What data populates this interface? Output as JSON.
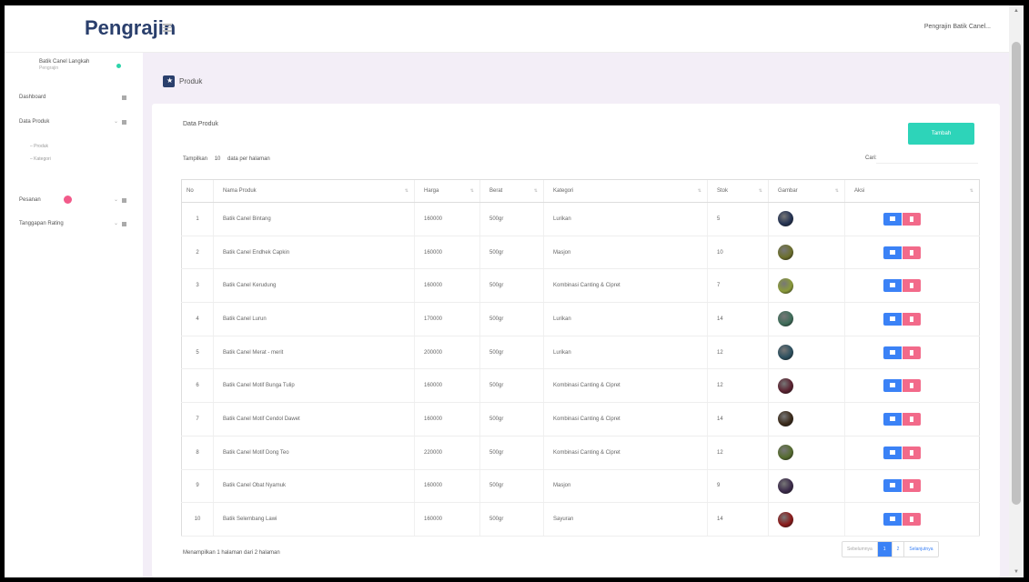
{
  "header": {
    "brand": "Pengrajin",
    "user": "Pengrajin Batik Canel..."
  },
  "sidebar": {
    "profile_name": "Batik Canel Langkah",
    "profile_role": "Pengrajin",
    "items": [
      {
        "label": "Dashboard"
      },
      {
        "label": "Data Produk"
      },
      {
        "label": "Pesanan"
      },
      {
        "label": "Tanggapan Rating"
      }
    ],
    "subitems": [
      {
        "label": "Produk"
      },
      {
        "label": "Kategori"
      }
    ]
  },
  "page": {
    "title": "Produk"
  },
  "card": {
    "title": "Data Produk",
    "add_label": "Tambah",
    "show_label": "Tampilkan",
    "show_value": "10",
    "show_suffix": "data per halaman",
    "search_label": "Cari:",
    "info": "Menampilkan 1 halaman dari 2 halaman"
  },
  "table": {
    "headers": [
      "No",
      "Nama Produk",
      "Harga",
      "Berat",
      "Kategori",
      "Stok",
      "Gambar",
      "Aksi"
    ],
    "rows": [
      {
        "no": "1",
        "nama": "Batik Canel Bintang",
        "harga": "160000",
        "berat": "500gr",
        "kategori": "Lurikan",
        "stok": "5"
      },
      {
        "no": "2",
        "nama": "Batik Canel Endhek Capkin",
        "harga": "160000",
        "berat": "500gr",
        "kategori": "Masjon",
        "stok": "10"
      },
      {
        "no": "3",
        "nama": "Batik Canel Kerudung",
        "harga": "160000",
        "berat": "500gr",
        "kategori": "Kombinasi Canting & Cipret",
        "stok": "7"
      },
      {
        "no": "4",
        "nama": "Batik Canel Lurun",
        "harga": "170000",
        "berat": "500gr",
        "kategori": "Lurikan",
        "stok": "14"
      },
      {
        "no": "5",
        "nama": "Batik Canel Merat - merit",
        "harga": "200000",
        "berat": "500gr",
        "kategori": "Lurikan",
        "stok": "12"
      },
      {
        "no": "6",
        "nama": "Batik Canel Motif Bunga Tulip",
        "harga": "160000",
        "berat": "500gr",
        "kategori": "Kombinasi Canting & Cipret",
        "stok": "12"
      },
      {
        "no": "7",
        "nama": "Batik Canel Motif Cendol Dawet",
        "harga": "160000",
        "berat": "500gr",
        "kategori": "Kombinasi Canting & Cipret",
        "stok": "14"
      },
      {
        "no": "8",
        "nama": "Batik Canel Motif Dong Teo",
        "harga": "220000",
        "berat": "500gr",
        "kategori": "Kombinasi Canting & Cipret",
        "stok": "12"
      },
      {
        "no": "9",
        "nama": "Batik Canel Obat Nyamuk",
        "harga": "160000",
        "berat": "500gr",
        "kategori": "Masjon",
        "stok": "9"
      },
      {
        "no": "10",
        "nama": "Batik Selembang Lawi",
        "harga": "160000",
        "berat": "500gr",
        "kategori": "Sayuran",
        "stok": "14"
      }
    ]
  },
  "thumb_colors": [
    "#243252",
    "#6b6e2c",
    "#8a9a3a",
    "#3f6d5a",
    "#2c4f5e",
    "#5a2230",
    "#3a2a1a",
    "#556b2f",
    "#3b2a4a",
    "#8a1a1a"
  ],
  "pagination": {
    "prev": "Sebelumnya",
    "current": "1",
    "next_page": "2",
    "next": "Selanjutnya"
  }
}
